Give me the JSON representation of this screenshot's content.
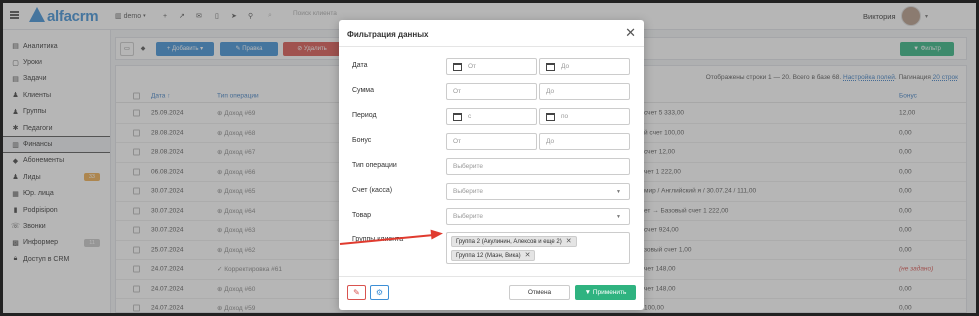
{
  "topbar": {
    "logo": "alfacrm",
    "branch": "demo",
    "search_placeholder": "Поиск клиента",
    "user_name": "Виктория"
  },
  "sidebar": {
    "items": [
      {
        "label": "Аналитика",
        "icon": "chart-icon"
      },
      {
        "label": "Уроки",
        "icon": "calendar-icon"
      },
      {
        "label": "Задачи",
        "icon": "tasks-icon"
      },
      {
        "label": "Клиенты",
        "icon": "user-icon"
      },
      {
        "label": "Группы",
        "icon": "users-icon"
      },
      {
        "label": "Педагоги",
        "icon": "teacher-icon"
      },
      {
        "label": "Финансы",
        "icon": "finance-icon",
        "active": true
      },
      {
        "label": "Абонементы",
        "icon": "tag-icon"
      },
      {
        "label": "Лиды",
        "icon": "lead-icon",
        "badge": "33",
        "badge_color": "#f0ad4e"
      },
      {
        "label": "Юр. лица",
        "icon": "building-icon"
      },
      {
        "label": "Podpisipon",
        "icon": "doc-icon"
      },
      {
        "label": "Звонки",
        "icon": "phone-icon"
      },
      {
        "label": "Информер",
        "icon": "informer-icon",
        "badge": "11",
        "badge_color": "#c8c8c8"
      },
      {
        "label": "Доступ в CRM",
        "icon": "lock-icon"
      }
    ]
  },
  "toolbar": {
    "add_label": "+ Добавить ▾",
    "edit_label": "✎ Правка",
    "delete_label": "⊘ Удалить",
    "filter_label": "▼ Фильтр"
  },
  "table": {
    "info_prefix": "Отображены строки 1 — 20. Всего в базе 68.",
    "settings_link": "Настройка полей",
    "pagination_text": "Пагинация",
    "pagination_link": "20 строк",
    "headers": {
      "date": "Дата ↑",
      "type": "Тип операции",
      "bonus": "Бонус"
    },
    "rows": [
      {
        "date": "25.09.2024",
        "type": "⊕ Доход #69",
        "desc": "счет 5 333,00",
        "bonus": "12,00"
      },
      {
        "date": "28.08.2024",
        "type": "⊕ Доход #68",
        "desc": "й счет 100,00",
        "bonus": "0,00"
      },
      {
        "date": "28.08.2024",
        "type": "⊕ Доход #67",
        "desc": "счет 12,00",
        "bonus": "0,00"
      },
      {
        "date": "06.08.2024",
        "type": "⊕ Доход #66",
        "desc": "чет 1 222,00",
        "bonus": "0,00"
      },
      {
        "date": "30.07.2024",
        "type": "⊕ Доход #65",
        "desc": "мир / Английский я / 30.07.24 / 111,00",
        "bonus": "0,00"
      },
      {
        "date": "30.07.2024",
        "type": "⊕ Доход #64",
        "desc": "ет → Базовый счет 1 222,00",
        "bonus": "0,00"
      },
      {
        "date": "30.07.2024",
        "type": "⊕ Доход #63",
        "desc": "счет 924,00",
        "bonus": "0,00"
      },
      {
        "date": "25.07.2024",
        "type": "⊕ Доход #62",
        "desc": "зовый счет 1,00",
        "bonus": "0,00"
      },
      {
        "date": "24.07.2024",
        "type": "✓ Корректировка #61",
        "desc": "чет 148,00",
        "bonus": "(не задано)"
      },
      {
        "date": "24.07.2024",
        "type": "⊕ Доход #60",
        "desc": "чет 148,00",
        "bonus": "0,00"
      },
      {
        "date": "24.07.2024",
        "type": "⊕ Доход #59",
        "desc": "100,00",
        "bonus": "0,00"
      }
    ]
  },
  "modal": {
    "title": "Фильтрация данных",
    "fields": {
      "date": {
        "label": "Дата",
        "from": "От",
        "to": "До"
      },
      "sum": {
        "label": "Сумма",
        "from": "От",
        "to": "До"
      },
      "period": {
        "label": "Период",
        "from": "с",
        "to": "по"
      },
      "bonus": {
        "label": "Бонус",
        "from": "От",
        "to": "До"
      },
      "op_type": {
        "label": "Тип операции",
        "placeholder": "Выберите"
      },
      "account": {
        "label": "Счет (касса)",
        "placeholder": "Выберите"
      },
      "product": {
        "label": "Товар",
        "placeholder": "Выберите"
      },
      "groups": {
        "label": "Группы клиента",
        "tags": [
          "Группа 2 (Акулинин, Алексов и еще 2)",
          "Группа 12 (Маэн, Вика)"
        ]
      }
    },
    "cancel_label": "Отмена",
    "apply_label": "▼ Применить"
  },
  "colors": {
    "accent": "#3d8fd6",
    "success": "#2fb380",
    "danger": "#d9534f",
    "arrow": "#e03b2f"
  }
}
